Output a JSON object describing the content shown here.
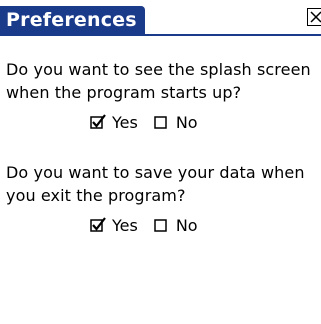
{
  "window": {
    "title": "Preferences",
    "close_icon": "close-x-icon"
  },
  "prefs": [
    {
      "question_line1": "Do you want to see the splash screen",
      "question_line2": "when the program starts up?",
      "yes_label": "Yes",
      "no_label": "No",
      "yes_checked": true,
      "no_checked": false
    },
    {
      "question_line1": "Do you want to save your data when",
      "question_line2": "you exit the program?",
      "yes_label": "Yes",
      "no_label": "No",
      "yes_checked": true,
      "no_checked": false
    }
  ],
  "colors": {
    "title_bar": "#1a3a8a",
    "title_text": "#ffffff"
  }
}
